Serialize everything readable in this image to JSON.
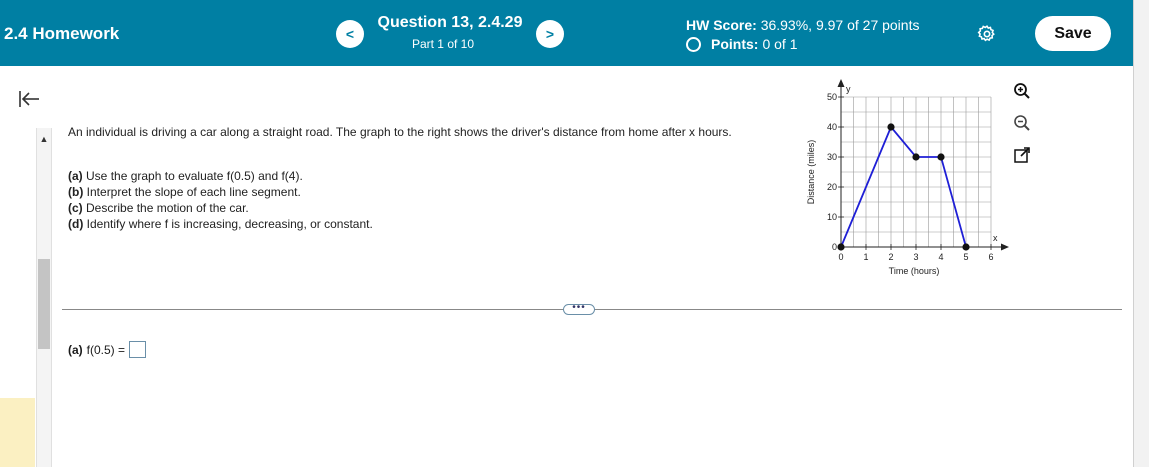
{
  "header": {
    "title": "2.4 Homework",
    "prev_label": "<",
    "next_label": ">",
    "question_title": "Question 13, 2.4.29",
    "question_part": "Part 1 of 10",
    "hw_score_label": "HW Score:",
    "hw_score_value": "36.93%, 9.97 of 27 points",
    "points_label": "Points:",
    "points_value": "0 of 1",
    "save_label": "Save"
  },
  "question": {
    "intro": "An individual is driving a car along a straight road. The graph to the right shows the driver's distance from home after x hours.",
    "parts": [
      {
        "label": "(a)",
        "text": "Use the graph to evaluate f(0.5) and f(4)."
      },
      {
        "label": "(b)",
        "text": "Interpret the slope of each line segment."
      },
      {
        "label": "(c)",
        "text": "Describe the motion of the car."
      },
      {
        "label": "(d)",
        "text": "Identify where f is increasing, decreasing, or constant."
      }
    ],
    "expand_label": "•••"
  },
  "answer": {
    "label": "(a)",
    "expression": "f(0.5) ="
  },
  "chart_data": {
    "type": "line",
    "xlabel": "Time (hours)",
    "ylabel": "Distance (miles)",
    "x_axis_name": "x",
    "y_axis_name": "y",
    "xlim": [
      0,
      6
    ],
    "ylim": [
      0,
      50
    ],
    "x_ticks": [
      0,
      1,
      2,
      3,
      4,
      5,
      6
    ],
    "y_ticks": [
      0,
      10,
      20,
      30,
      40,
      50
    ],
    "grid": true,
    "line_color": "#1f1fd6",
    "points": [
      {
        "x": 0,
        "y": 0
      },
      {
        "x": 2,
        "y": 40
      },
      {
        "x": 3,
        "y": 30
      },
      {
        "x": 4,
        "y": 30
      },
      {
        "x": 5,
        "y": 0
      }
    ]
  },
  "icons": {
    "collapse": "collapse-left-icon",
    "settings": "gear-icon",
    "zoom_in": "zoom-in-icon",
    "zoom_out": "zoom-out-icon",
    "popout": "popout-icon"
  }
}
